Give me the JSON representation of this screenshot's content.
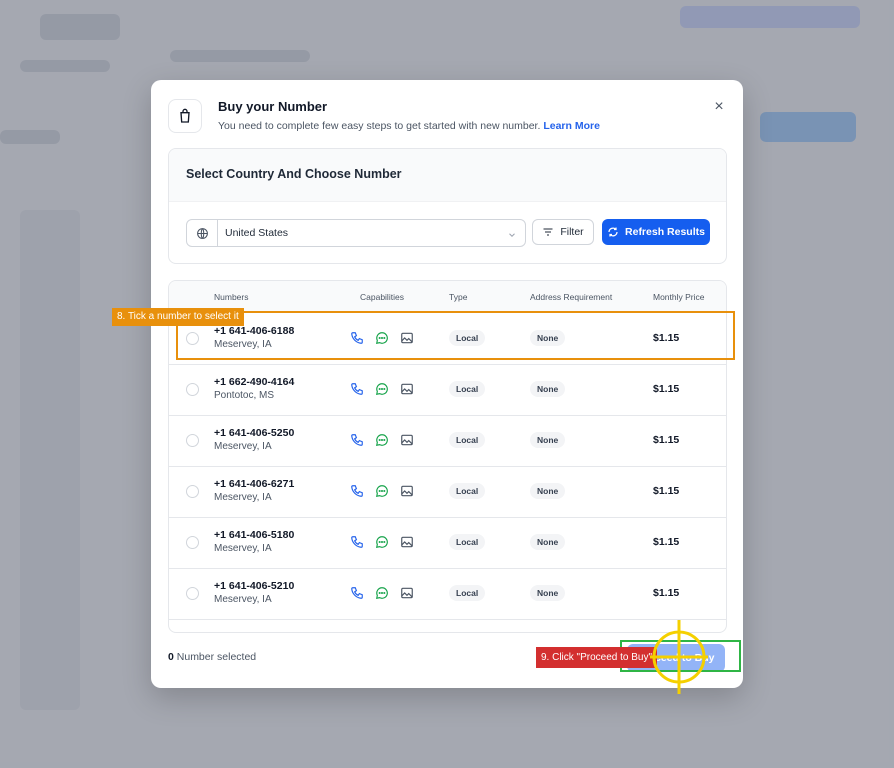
{
  "modal": {
    "title": "Buy your Number",
    "subtitle": "You need to complete few easy steps to get started with new number.",
    "learn_more": "Learn More",
    "close_glyph": "×",
    "icon": "shopping-bag-icon"
  },
  "selector": {
    "title": "Select Country And Choose Number",
    "country": "United States",
    "filter_label": "Filter",
    "refresh_label": "Refresh Results"
  },
  "table": {
    "columns": [
      "Numbers",
      "Capabilities",
      "Type",
      "Address Requirement",
      "Monthly Price"
    ],
    "rows": [
      {
        "number": "+1 641-406-6188",
        "location": "Meservey, IA",
        "type": "Local",
        "address": "None",
        "price": "$1.15"
      },
      {
        "number": "+1 662-490-4164",
        "location": "Pontotoc, MS",
        "type": "Local",
        "address": "None",
        "price": "$1.15"
      },
      {
        "number": "+1 641-406-5250",
        "location": "Meservey, IA",
        "type": "Local",
        "address": "None",
        "price": "$1.15"
      },
      {
        "number": "+1 641-406-6271",
        "location": "Meservey, IA",
        "type": "Local",
        "address": "None",
        "price": "$1.15"
      },
      {
        "number": "+1 641-406-5180",
        "location": "Meservey, IA",
        "type": "Local",
        "address": "None",
        "price": "$1.15"
      },
      {
        "number": "+1 641-406-5210",
        "location": "Meservey, IA",
        "type": "Local",
        "address": "None",
        "price": "$1.15"
      }
    ]
  },
  "footer": {
    "selected_count": "0",
    "selected_text": "Number selected",
    "proceed_label": "Proceed to Buy"
  },
  "tutorial": {
    "step8": "8. Tick a number to select it",
    "step9": "9. Click \"Proceed to Buy\"",
    "colors": {
      "orange": "#e8900c",
      "red": "#d32f2f",
      "green": "#2fb545",
      "yellow": "#f5d000"
    }
  },
  "colors": {
    "primary": "#155eef",
    "phone": "#2563eb",
    "sms": "#16a34a",
    "mms": "#4b5563"
  }
}
